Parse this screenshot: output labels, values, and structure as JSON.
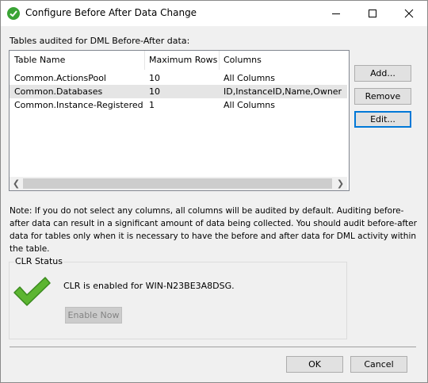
{
  "window": {
    "title": "Configure Before After Data Change",
    "minimize_icon": "minimize-icon",
    "maximize_icon": "maximize-icon",
    "close_icon": "close-icon"
  },
  "tables_label": "Tables audited for DML Before-After data:",
  "table": {
    "columns": [
      "Table Name",
      "Maximum Rows",
      "Columns"
    ],
    "rows": [
      {
        "name": "Common.ActionsPool",
        "max_rows": "10",
        "columns": "All Columns",
        "selected": false
      },
      {
        "name": "Common.Databases",
        "max_rows": "10",
        "columns": "ID,InstanceID,Name,Owner",
        "selected": true
      },
      {
        "name": "Common.Instance-RegisteredPr...",
        "max_rows": "1",
        "columns": "All Columns",
        "selected": false
      }
    ]
  },
  "buttons": {
    "add": "Add...",
    "remove": "Remove",
    "edit": "Edit...",
    "enable_now": "Enable Now",
    "ok": "OK",
    "cancel": "Cancel"
  },
  "note": "Note: If you do not select any columns, all columns will be audited by default. Auditing before-after data can result in a significant amount of data being collected. You should audit before-after data for tables only when it is necessary to have the before and after data for DML activity within the table.",
  "clr": {
    "group_title": "CLR Status",
    "status_text": "CLR is enabled for WIN-N23BE3A8DSG.",
    "status_icon": "checkmark-icon"
  },
  "colors": {
    "accent": "#0078d7",
    "check_green": "#3aa435",
    "selected_row": "#e5e5e5"
  }
}
